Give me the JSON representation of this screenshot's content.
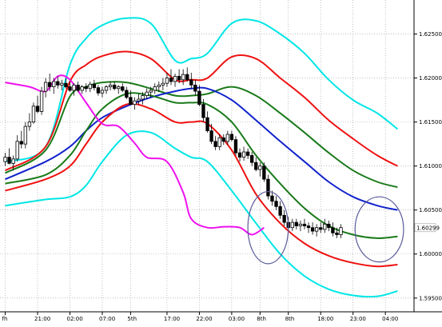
{
  "chart_data": {
    "type": "line",
    "title": "",
    "y_ticks": [
      "1.62500",
      "1.62000",
      "1.61500",
      "1.61000",
      "1.60500",
      "1.60000",
      "1.59500"
    ],
    "y_tick_values": [
      1.625,
      1.62,
      1.615,
      1.61,
      1.605,
      1.6,
      1.595
    ],
    "ylim": [
      1.5938,
      1.6285
    ],
    "grid": true,
    "current_price_label": "1.60299",
    "current_price": 1.60299,
    "x_tick_labels": [
      "fh",
      "21:00",
      "02:00",
      "07:00",
      "5th",
      "17:00",
      "22:00",
      "03:00",
      "8th",
      "8th",
      "18:00",
      "23:00",
      "04:00"
    ],
    "x_tick_index": [
      0,
      8,
      16,
      24,
      31,
      40,
      48,
      56,
      63,
      70,
      78,
      86,
      94
    ],
    "n_bars": 100,
    "series": [
      {
        "color": "#00e6e6",
        "x": [
          0,
          10,
          16,
          20,
          24,
          30,
          36,
          42,
          46,
          50,
          56,
          62,
          68,
          74,
          80,
          86,
          92,
          97
        ],
        "values": [
          1.6105,
          1.6122,
          1.6215,
          1.6245,
          1.626,
          1.6268,
          1.6262,
          1.622,
          1.6222,
          1.6228,
          1.6262,
          1.6265,
          1.625,
          1.6228,
          1.6198,
          1.6175,
          1.616,
          1.6142
        ]
      },
      {
        "color": "#ee1111",
        "x": [
          0,
          10,
          16,
          20,
          24,
          30,
          36,
          42,
          46,
          50,
          56,
          62,
          68,
          74,
          80,
          86,
          92,
          97
        ],
        "values": [
          1.6095,
          1.6122,
          1.6196,
          1.6215,
          1.6225,
          1.623,
          1.6222,
          1.6198,
          1.6198,
          1.62,
          1.6224,
          1.6222,
          1.62,
          1.6178,
          1.6152,
          1.6131,
          1.6112,
          1.61
        ]
      },
      {
        "color": "#1a7a1a",
        "x": [
          0,
          10,
          16,
          20,
          24,
          30,
          36,
          42,
          46,
          50,
          56,
          62,
          68,
          74,
          80,
          86,
          92,
          97
        ],
        "values": [
          1.6092,
          1.6118,
          1.6179,
          1.619,
          1.6195,
          1.6195,
          1.6188,
          1.618,
          1.618,
          1.6182,
          1.619,
          1.618,
          1.616,
          1.6138,
          1.6115,
          1.6095,
          1.6082,
          1.6076
        ]
      },
      {
        "color": "#1122cc",
        "x": [
          0,
          10,
          16,
          20,
          24,
          30,
          36,
          42,
          46,
          50,
          56,
          62,
          68,
          74,
          80,
          86,
          92,
          97
        ],
        "values": [
          1.6085,
          1.6105,
          1.6122,
          1.614,
          1.6155,
          1.6168,
          1.6178,
          1.6185,
          1.6188,
          1.6188,
          1.6175,
          1.6152,
          1.6128,
          1.6105,
          1.6082,
          1.6065,
          1.6055,
          1.605
        ]
      },
      {
        "color": "#1a7a1a",
        "x": [
          0,
          10,
          16,
          20,
          24,
          30,
          36,
          42,
          46,
          50,
          56,
          62,
          68,
          74,
          80,
          86,
          92,
          97
        ],
        "values": [
          1.608,
          1.609,
          1.6112,
          1.614,
          1.6165,
          1.6182,
          1.618,
          1.6172,
          1.6172,
          1.617,
          1.615,
          1.6112,
          1.608,
          1.6052,
          1.6032,
          1.6022,
          1.6018,
          1.602
        ]
      },
      {
        "color": "#ee1111",
        "x": [
          0,
          10,
          16,
          20,
          24,
          30,
          36,
          42,
          46,
          50,
          56,
          62,
          68,
          74,
          80,
          86,
          92,
          97
        ],
        "values": [
          1.6072,
          1.6085,
          1.61,
          1.6125,
          1.615,
          1.617,
          1.6165,
          1.615,
          1.615,
          1.6148,
          1.6118,
          1.6068,
          1.6035,
          1.6012,
          1.5998,
          1.599,
          1.5986,
          1.5988
        ]
      },
      {
        "color": "#00e6e6",
        "x": [
          0,
          10,
          16,
          20,
          24,
          30,
          36,
          42,
          46,
          50,
          56,
          62,
          68,
          74,
          80,
          86,
          92,
          97
        ],
        "values": [
          1.6055,
          1.6062,
          1.6065,
          1.6078,
          1.6105,
          1.6135,
          1.6138,
          1.612,
          1.611,
          1.6105,
          1.6072,
          1.6035,
          1.6,
          1.5975,
          1.596,
          1.5953,
          1.5952,
          1.5958
        ]
      },
      {
        "color": "#ee11ee",
        "x": [
          0,
          6,
          10,
          13,
          16,
          20,
          24,
          28,
          32,
          35,
          40,
          44,
          46,
          50,
          54,
          58,
          61,
          64
        ],
        "values": [
          1.6195,
          1.619,
          1.6185,
          1.6202,
          1.6198,
          1.6172,
          1.6148,
          1.6145,
          1.6126,
          1.611,
          1.6105,
          1.607,
          1.604,
          1.603,
          1.6031,
          1.603,
          1.6022,
          1.603
        ]
      }
    ],
    "candles": [
      [
        1.6105,
        1.6115,
        1.61,
        1.611
      ],
      [
        1.611,
        1.612,
        1.6102,
        1.6103
      ],
      [
        1.6103,
        1.6112,
        1.6095,
        1.6108
      ],
      [
        1.6108,
        1.6135,
        1.6105,
        1.6128
      ],
      [
        1.6128,
        1.614,
        1.612,
        1.6125
      ],
      [
        1.6125,
        1.615,
        1.612,
        1.6145
      ],
      [
        1.6145,
        1.616,
        1.614,
        1.615
      ],
      [
        1.615,
        1.6172,
        1.6148,
        1.6168
      ],
      [
        1.6168,
        1.618,
        1.616,
        1.6162
      ],
      [
        1.6162,
        1.619,
        1.6158,
        1.6185
      ],
      [
        1.6185,
        1.62,
        1.6178,
        1.6195
      ],
      [
        1.6195,
        1.6205,
        1.6185,
        1.619
      ],
      [
        1.619,
        1.62,
        1.6182,
        1.6196
      ],
      [
        1.6196,
        1.6202,
        1.6188,
        1.6192
      ],
      [
        1.6192,
        1.6198,
        1.6186,
        1.6194
      ],
      [
        1.6194,
        1.62,
        1.6188,
        1.619
      ],
      [
        1.619,
        1.6196,
        1.6184,
        1.6186
      ],
      [
        1.6186,
        1.6194,
        1.618,
        1.6192
      ],
      [
        1.6192,
        1.6196,
        1.6184,
        1.6186
      ],
      [
        1.6186,
        1.6192,
        1.6182,
        1.619
      ],
      [
        1.619,
        1.6194,
        1.6184,
        1.6188
      ],
      [
        1.6188,
        1.6196,
        1.6184,
        1.6193
      ],
      [
        1.6193,
        1.6198,
        1.6186,
        1.6189
      ],
      [
        1.6189,
        1.6192,
        1.618,
        1.6183
      ],
      [
        1.6183,
        1.619,
        1.6178,
        1.6186
      ],
      [
        1.6186,
        1.6192,
        1.6182,
        1.619
      ],
      [
        1.619,
        1.6196,
        1.6186,
        1.6192
      ],
      [
        1.6192,
        1.6196,
        1.6186,
        1.6188
      ],
      [
        1.6188,
        1.6192,
        1.6182,
        1.619
      ],
      [
        1.619,
        1.6194,
        1.6184,
        1.6186
      ],
      [
        1.6186,
        1.619,
        1.6176,
        1.6178
      ],
      [
        1.6178,
        1.6186,
        1.6172,
        1.617
      ],
      [
        1.617,
        1.6178,
        1.6164,
        1.6174
      ],
      [
        1.6174,
        1.6182,
        1.617,
        1.6176
      ],
      [
        1.6176,
        1.6184,
        1.617,
        1.618
      ],
      [
        1.618,
        1.6188,
        1.6176,
        1.6184
      ],
      [
        1.6184,
        1.619,
        1.6178,
        1.6186
      ],
      [
        1.6186,
        1.6194,
        1.6182,
        1.619
      ],
      [
        1.619,
        1.6196,
        1.6184,
        1.6192
      ],
      [
        1.6192,
        1.62,
        1.6186,
        1.6194
      ],
      [
        1.6194,
        1.6206,
        1.619,
        1.62
      ],
      [
        1.62,
        1.621,
        1.6192,
        1.6196
      ],
      [
        1.6196,
        1.6205,
        1.619,
        1.6202
      ],
      [
        1.6202,
        1.621,
        1.6194,
        1.6198
      ],
      [
        1.6198,
        1.621,
        1.6192,
        1.6204
      ],
      [
        1.6204,
        1.6212,
        1.6196,
        1.6198
      ],
      [
        1.6198,
        1.6206,
        1.6188,
        1.6192
      ],
      [
        1.6192,
        1.6198,
        1.618,
        1.6185
      ],
      [
        1.6185,
        1.6192,
        1.6168,
        1.617
      ],
      [
        1.617,
        1.6176,
        1.615,
        1.6155
      ],
      [
        1.6155,
        1.6162,
        1.6138,
        1.614
      ],
      [
        1.614,
        1.6148,
        1.6125,
        1.6128
      ],
      [
        1.6128,
        1.6134,
        1.6118,
        1.6122
      ],
      [
        1.6122,
        1.6136,
        1.6118,
        1.6132
      ],
      [
        1.6132,
        1.6136,
        1.6124,
        1.6128
      ],
      [
        1.6128,
        1.614,
        1.6124,
        1.6136
      ],
      [
        1.6136,
        1.614,
        1.6128,
        1.613
      ],
      [
        1.613,
        1.6134,
        1.6112,
        1.6115
      ],
      [
        1.6115,
        1.612,
        1.6105,
        1.611
      ],
      [
        1.611,
        1.6122,
        1.6106,
        1.6116
      ],
      [
        1.6116,
        1.612,
        1.6108,
        1.6112
      ],
      [
        1.6112,
        1.6116,
        1.61,
        1.6104
      ],
      [
        1.6104,
        1.611,
        1.6094,
        1.6096
      ],
      [
        1.6096,
        1.6104,
        1.6088,
        1.61
      ],
      [
        1.61,
        1.6104,
        1.6082,
        1.6085
      ],
      [
        1.6085,
        1.609,
        1.6062,
        1.6066
      ],
      [
        1.6066,
        1.6072,
        1.6055,
        1.606
      ],
      [
        1.606,
        1.6066,
        1.605,
        1.6054
      ],
      [
        1.6054,
        1.606,
        1.604,
        1.6044
      ],
      [
        1.6044,
        1.605,
        1.6032,
        1.6036
      ],
      [
        1.6036,
        1.6042,
        1.6026,
        1.603
      ],
      [
        1.603,
        1.604,
        1.6026,
        1.6036
      ],
      [
        1.6036,
        1.604,
        1.6028,
        1.6032
      ],
      [
        1.6032,
        1.6038,
        1.6026,
        1.6034
      ],
      [
        1.6034,
        1.604,
        1.6028,
        1.6032
      ],
      [
        1.6032,
        1.6036,
        1.6024,
        1.603
      ],
      [
        1.603,
        1.6036,
        1.6022,
        1.6026
      ],
      [
        1.6026,
        1.6034,
        1.602,
        1.603
      ],
      [
        1.603,
        1.6036,
        1.6024,
        1.6028
      ],
      [
        1.6028,
        1.604,
        1.6024,
        1.6034
      ],
      [
        1.6034,
        1.6038,
        1.6026,
        1.603
      ],
      [
        1.603,
        1.6036,
        1.602,
        1.6024
      ],
      [
        1.6024,
        1.603,
        1.6018,
        1.6022
      ],
      [
        1.6022,
        1.6034,
        1.6018,
        1.603
      ]
    ],
    "annotations": [
      {
        "shape": "ellipse",
        "center_bar": 65,
        "center_price": 1.603,
        "bar_radius": 5,
        "price_radius": 0.0041
      },
      {
        "shape": "ellipse",
        "center_bar": 92.5,
        "center_price": 1.6028,
        "bar_radius": 6,
        "price_radius": 0.0037
      }
    ]
  }
}
